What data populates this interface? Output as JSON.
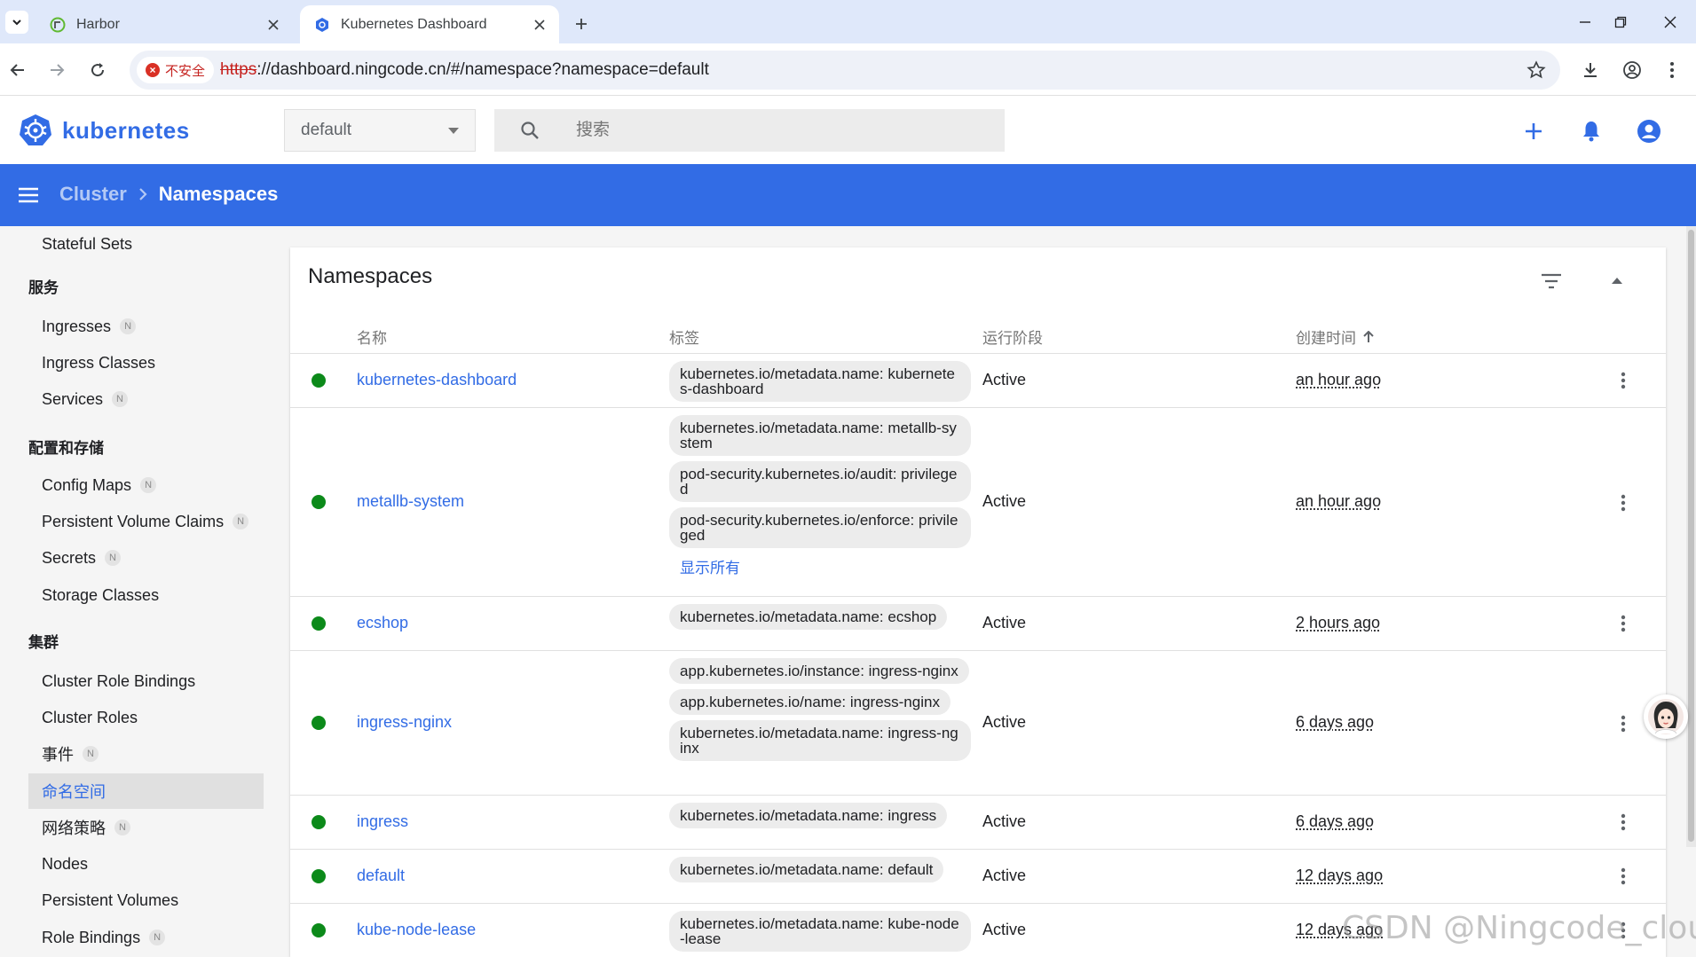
{
  "browser": {
    "tabs": [
      {
        "title": "Harbor",
        "active": false
      },
      {
        "title": "Kubernetes Dashboard",
        "active": true
      }
    ],
    "security_label": "不安全",
    "url_scheme": "https",
    "url_rest": "://dashboard.ningcode.cn/#/namespace?namespace=default"
  },
  "header": {
    "logo_text": "kubernetes",
    "namespace_selected": "default",
    "search_placeholder": "搜索"
  },
  "breadcrumb": {
    "parent": "Cluster",
    "current": "Namespaces"
  },
  "sidebar": {
    "top_item": "Stateful Sets",
    "sections": {
      "service": "服务",
      "config": "配置和存储",
      "cluster": "集群"
    },
    "items": {
      "ingresses": "Ingresses",
      "ingress_classes": "Ingress Classes",
      "services": "Services",
      "config_maps": "Config Maps",
      "pvcs": "Persistent Volume Claims",
      "secrets": "Secrets",
      "storage_classes": "Storage Classes",
      "cluster_role_bindings": "Cluster Role Bindings",
      "cluster_roles": "Cluster Roles",
      "events": "事件",
      "namespaces": "命名空间",
      "network_policies": "网络策略",
      "nodes": "Nodes",
      "persistent_volumes": "Persistent Volumes",
      "role_bindings": "Role Bindings"
    },
    "badge": "N"
  },
  "card": {
    "title": "Namespaces",
    "columns": {
      "name": "名称",
      "labels": "标签",
      "phase": "运行阶段",
      "created": "创建时间"
    }
  },
  "rows": [
    {
      "name": "kubernetes-dashboard",
      "labels": [
        "kubernetes.io/metadata.name: kubernetes-dashboard"
      ],
      "phase": "Active",
      "age": "an hour ago"
    },
    {
      "name": "metallb-system",
      "labels": [
        "kubernetes.io/metadata.name: metallb-system",
        "pod-security.kubernetes.io/audit: privileged",
        "pod-security.kubernetes.io/enforce: privileged"
      ],
      "show_all": "显示所有",
      "phase": "Active",
      "age": "an hour ago"
    },
    {
      "name": "ecshop",
      "labels": [
        "kubernetes.io/metadata.name: ecshop"
      ],
      "phase": "Active",
      "age": "2 hours ago"
    },
    {
      "name": "ingress-nginx",
      "labels": [
        "app.kubernetes.io/instance: ingress-nginx",
        "app.kubernetes.io/name: ingress-nginx",
        "kubernetes.io/metadata.name: ingress-nginx"
      ],
      "phase": "Active",
      "age": "6 days ago"
    },
    {
      "name": "ingress",
      "labels": [
        "kubernetes.io/metadata.name: ingress"
      ],
      "phase": "Active",
      "age": "6 days ago"
    },
    {
      "name": "default",
      "labels": [
        "kubernetes.io/metadata.name: default"
      ],
      "phase": "Active",
      "age": "12 days ago"
    },
    {
      "name": "kube-node-lease",
      "labels": [
        "kubernetes.io/metadata.name: kube-node-lease"
      ],
      "phase": "Active",
      "age": "12 days ago"
    }
  ],
  "watermark": "CSDN @Ningcode_cloud",
  "colors": {
    "brand_blue": "#326ce5",
    "status_green": "#0c8a1a",
    "tab_strip": "#dfe8fa"
  }
}
